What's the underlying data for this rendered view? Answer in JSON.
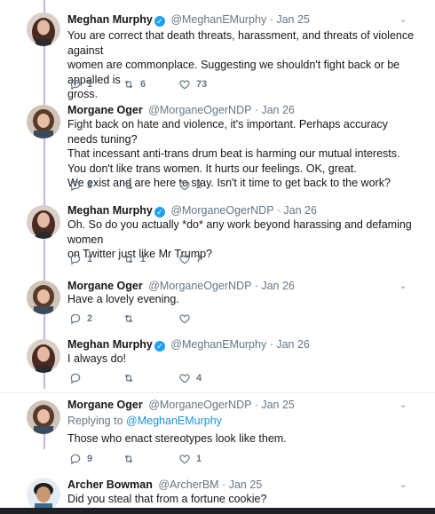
{
  "tweets": [
    {
      "name": "Meghan Murphy",
      "verified": true,
      "handle": "@MeghanEMurphy",
      "date": "· Jan 25",
      "lines": [
        "You are correct that death threats, harassment, and threats of violence against",
        "women are commonplace. Suggesting we shouldn't fight back or be appalled is",
        "gross."
      ],
      "replies": "1",
      "retweets": "6",
      "likes": "73"
    },
    {
      "name": "Morgane Oger",
      "verified": false,
      "handle": "@MorganeOgerNDP",
      "date": "· Jan 26",
      "lines": [
        "Fight back on hate and violence, it's important. Perhaps accuracy needs tuning?",
        "That incessant anti-trans drum beat is harming our mutual interests.",
        "You don't like trans women. It hurts our feelings. OK, great.",
        "We exist and are here to stay. Isn't it time to get back to the work?"
      ],
      "replies": "3",
      "retweets": "",
      "likes": "2"
    },
    {
      "name": "Meghan Murphy",
      "verified": true,
      "handle": "@MorganeOgerNDP",
      "date": "· Jan 26",
      "lines": [
        "Oh. So do you actually *do* any work beyond harassing and defaming women",
        "on Twitter just like Mr Trump?"
      ],
      "replies": "1",
      "retweets": "1",
      "likes": "7"
    },
    {
      "name": "Morgane Oger",
      "verified": false,
      "handle": "@MorganeOgerNDP",
      "date": "· Jan 26",
      "lines": [
        "Have a lovely evening."
      ],
      "replies": "2",
      "retweets": "",
      "likes": ""
    },
    {
      "name": "Meghan Murphy",
      "verified": true,
      "handle": "@MeghanEMurphy",
      "date": "· Jan 26",
      "lines": [
        "I always do!"
      ],
      "replies": "",
      "retweets": "",
      "likes": "4"
    },
    {
      "name": "Morgane Oger",
      "verified": false,
      "handle": "@MorganeOgerNDP",
      "date": "· Jan 25",
      "replying_prefix": "Replying to",
      "replying_to": "@MeghanEMurphy",
      "lines": [
        "Those who enact stereotypes look like them."
      ],
      "replies": "9",
      "retweets": "",
      "likes": "1"
    },
    {
      "name": "Archer Bowman",
      "verified": false,
      "handle": "@ArcherBM",
      "date": "· Jan 25",
      "lines": [
        "Did you steal that from a fortune cookie?"
      ],
      "replies": "",
      "retweets": "",
      "likes": ""
    }
  ],
  "icons": {
    "reply": "reply-icon",
    "retweet": "retweet-icon",
    "like": "heart-icon",
    "more": "chevron-down-icon",
    "verified": "verified-badge-icon"
  },
  "colors": {
    "thread_line": "#c4b5e8",
    "action_gray": "#657786",
    "link_blue": "#1b95e0",
    "verified_blue": "#1da1f2"
  }
}
